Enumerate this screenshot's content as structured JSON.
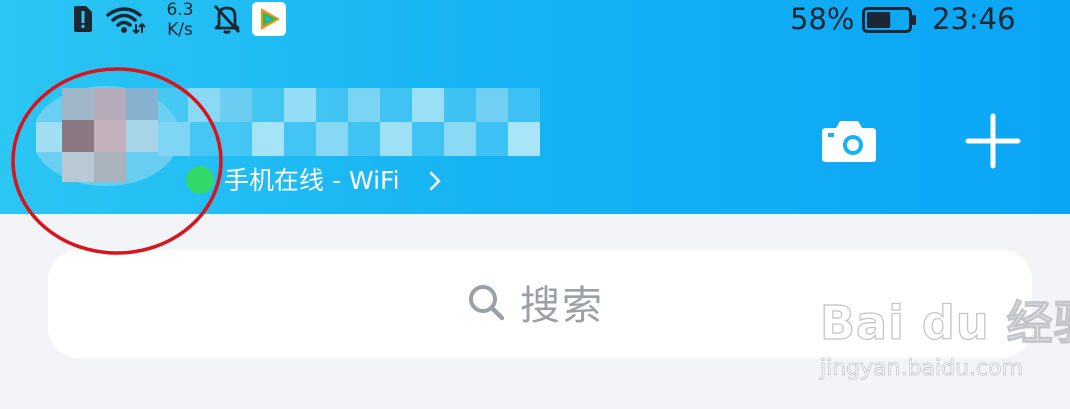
{
  "status_bar": {
    "network_speed_value": "6.3",
    "network_speed_unit": "K/s",
    "battery_percent": "58%",
    "battery_level": 0.58,
    "time": "23:46"
  },
  "profile": {
    "online_status": "手机在线 - WiFi",
    "online_color": "#31d86a"
  },
  "toolbar": {
    "camera_icon": "camera-icon",
    "add_icon": "plus-icon"
  },
  "search": {
    "placeholder": "搜索"
  },
  "watermark": {
    "brand": "Bai du 经验",
    "url": "jingyan.baidu.com"
  },
  "colors": {
    "header_start": "#2cc6f3",
    "header_end": "#0aa5f5",
    "annotation": "#d8141c"
  }
}
